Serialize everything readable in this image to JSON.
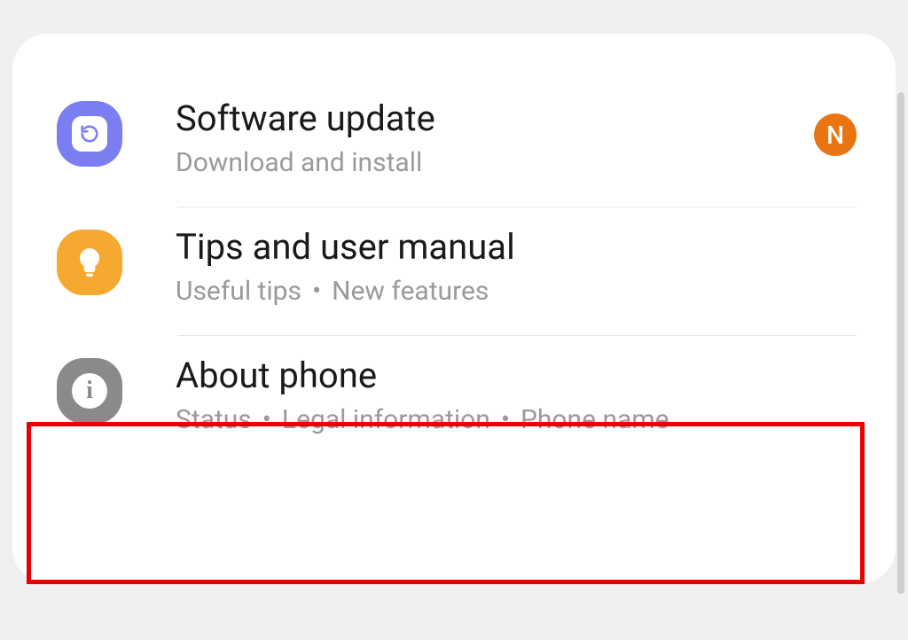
{
  "badge": {
    "letter": "N"
  },
  "items": [
    {
      "title": "Software update",
      "subtitle": [
        "Download and install"
      ],
      "icon": "refresh-icon",
      "color": "purple",
      "hasBadge": true
    },
    {
      "title": "Tips and user manual",
      "subtitle": [
        "Useful tips",
        "New features"
      ],
      "icon": "lightbulb-icon",
      "color": "orange",
      "hasBadge": false
    },
    {
      "title": "About phone",
      "subtitle": [
        "Status",
        "Legal information",
        "Phone name"
      ],
      "icon": "info-icon",
      "color": "grey",
      "hasBadge": false,
      "highlighted": true
    }
  ]
}
